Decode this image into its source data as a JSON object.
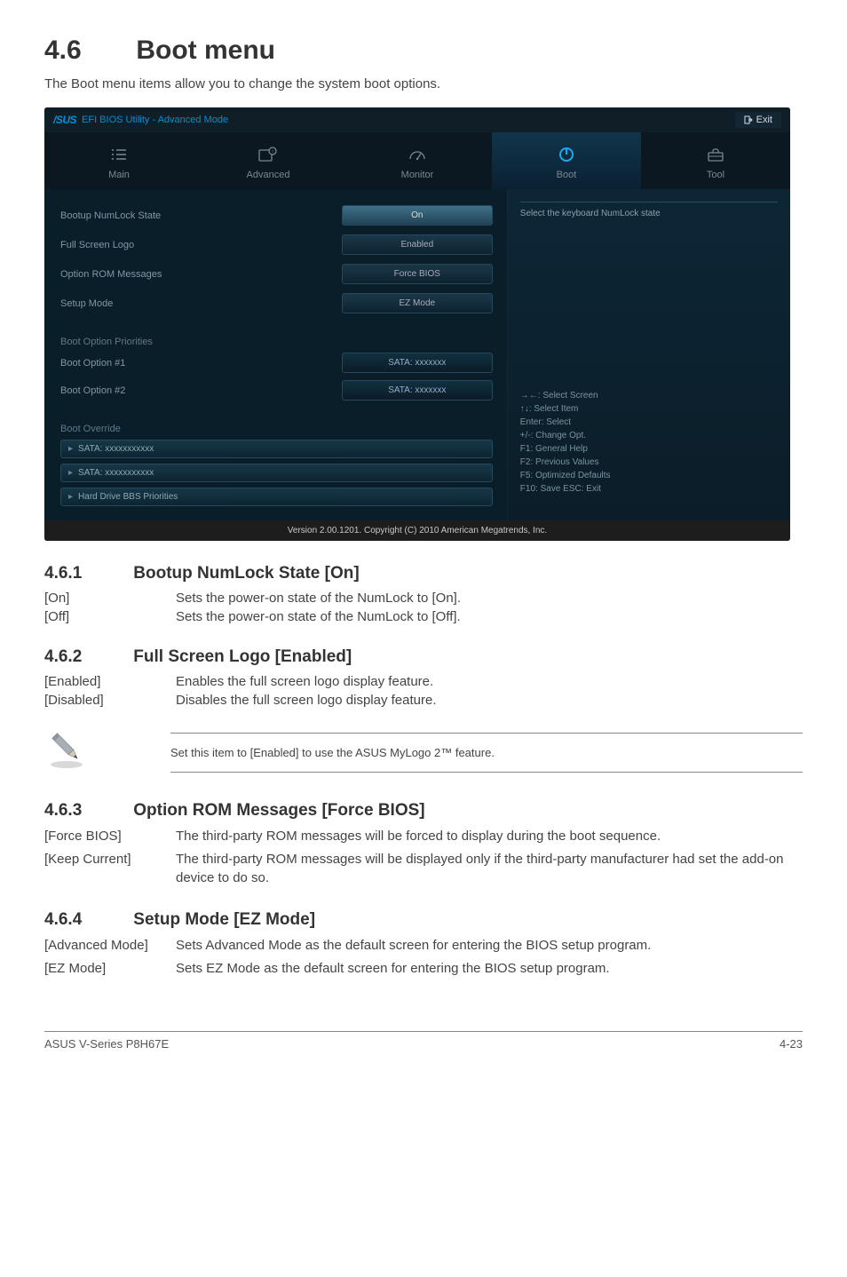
{
  "page": {
    "section_number": "4.6",
    "section_title": "Boot menu",
    "intro": "The Boot menu items allow you to change the system boot options."
  },
  "bios": {
    "brand_logo_text": "/SUS",
    "top_title": "EFI BIOS Utility - Advanced Mode",
    "exit_label": "Exit",
    "tabs": {
      "main": "Main",
      "advanced": "Advanced",
      "monitor": "Monitor",
      "boot": "Boot",
      "tool": "Tool"
    },
    "settings": {
      "bootup_numlock_label": "Bootup NumLock State",
      "bootup_numlock_value": "On",
      "full_screen_logo_label": "Full Screen Logo",
      "full_screen_logo_value": "Enabled",
      "option_rom_label": "Option ROM Messages",
      "option_rom_value": "Force BIOS",
      "setup_mode_label": "Setup Mode",
      "setup_mode_value": "EZ Mode"
    },
    "boot_priorities": {
      "group_label": "Boot Option Priorities",
      "opt1_label": "Boot Option #1",
      "opt1_value": "SATA: xxxxxxx",
      "opt2_label": "Boot Option #2",
      "opt2_value": "SATA: xxxxxxx"
    },
    "override": {
      "group_label": "Boot Override",
      "item1": "SATA: xxxxxxxxxxx",
      "item2": "SATA: xxxxxxxxxxx",
      "item3": "Hard Drive BBS Priorities"
    },
    "help_top": "Select the keyboard NumLock state",
    "hints": {
      "l1": "→←: Select Screen",
      "l2": "↑↓: Select Item",
      "l3": "Enter: Select",
      "l4": "+/-: Change Opt.",
      "l5": "F1: General Help",
      "l6": "F2: Previous Values",
      "l7": "F5: Optimized Defaults",
      "l8": "F10: Save   ESC: Exit"
    },
    "footer": "Version 2.00.1201.  Copyright (C) 2010 American Megatrends, Inc."
  },
  "doc": {
    "s461_num": "4.6.1",
    "s461_title": "Bootup NumLock State [On]",
    "s461_on_key": "[On]",
    "s461_on_val": "Sets the power-on state of the NumLock to [On].",
    "s461_off_key": "[Off]",
    "s461_off_val": "Sets the power-on state of the NumLock to [Off].",
    "s462_num": "4.6.2",
    "s462_title": "Full Screen Logo [Enabled]",
    "s462_en_key": "[Enabled]",
    "s462_en_val": "Enables the full screen logo display feature.",
    "s462_dis_key": "[Disabled]",
    "s462_dis_val": "Disables the full screen logo display feature.",
    "note": "Set this item to [Enabled] to use the ASUS MyLogo 2™ feature.",
    "s463_num": "4.6.3",
    "s463_title": "Option ROM Messages [Force BIOS]",
    "s463_fb_key": "[Force BIOS]",
    "s463_fb_val": "The third-party ROM messages will be forced to display during the boot sequence.",
    "s463_kc_key": "[Keep Current]",
    "s463_kc_val": "The third-party ROM messages will be displayed only if the third-party manufacturer had set the add-on device to do so.",
    "s464_num": "4.6.4",
    "s464_title": "Setup Mode [EZ Mode]",
    "s464_am_key": "[Advanced Mode]",
    "s464_am_val": "Sets Advanced Mode as the default screen for entering the BIOS setup program.",
    "s464_ez_key": "[EZ Mode]",
    "s464_ez_val": "Sets EZ Mode as the default screen for entering the BIOS setup program."
  },
  "footer": {
    "product": "ASUS V-Series P8H67E",
    "page_num": "4-23"
  }
}
